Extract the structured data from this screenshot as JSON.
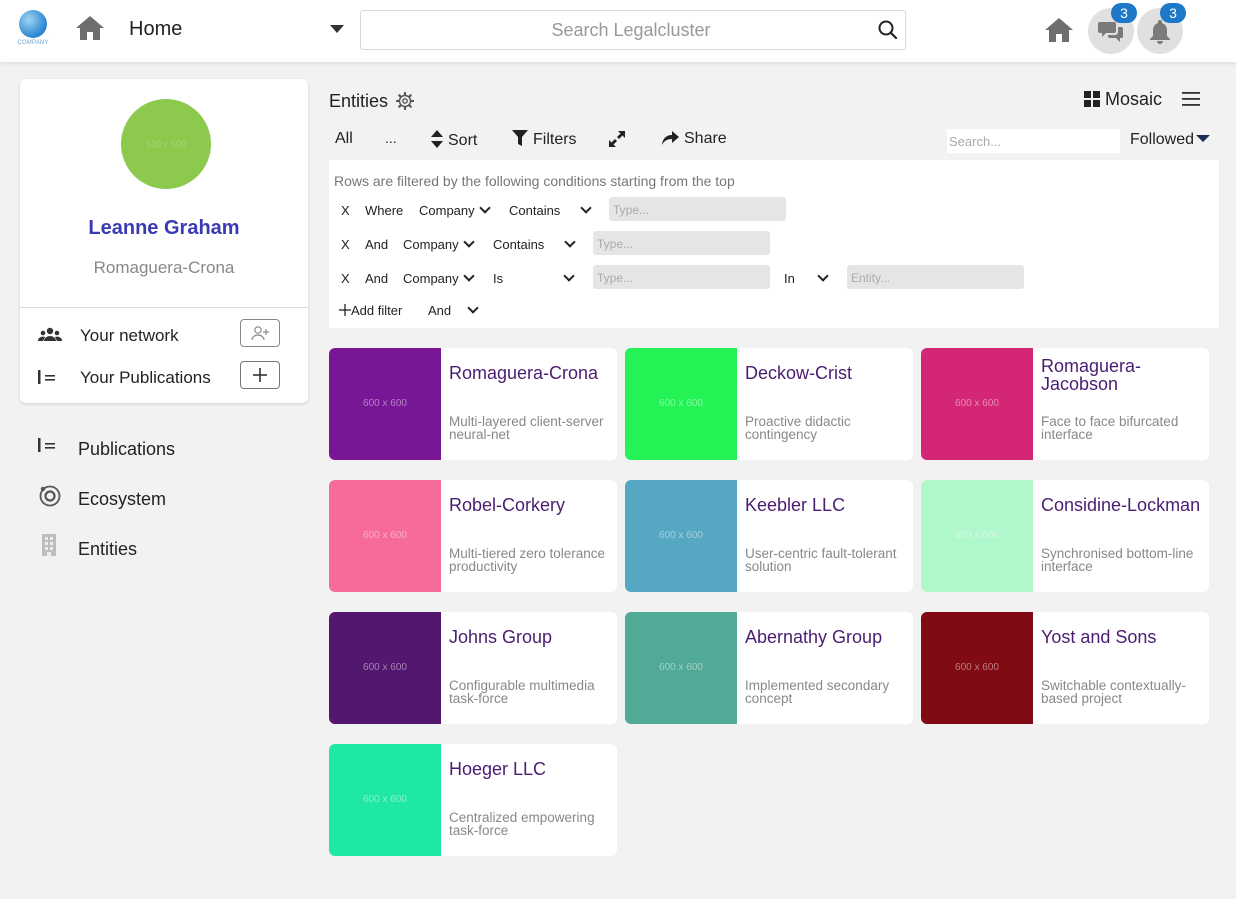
{
  "header": {
    "logo_text": "COMPANY",
    "title": "Home",
    "search_placeholder": "Search Legalcluster",
    "messages_count": "3",
    "notifications_count": "3"
  },
  "profile": {
    "avatar_text": "600 x 600",
    "avatar_color": "#8cc94d",
    "name": "Leanne Graham",
    "company": "Romaguera-Crona",
    "network_label": "Your network",
    "publications_label": "Your Publications"
  },
  "sidebar": {
    "items": [
      {
        "label": "Publications",
        "icon": "publications-icon"
      },
      {
        "label": "Ecosystem",
        "icon": "ecosystem-icon"
      },
      {
        "label": "Entities",
        "icon": "entities-icon"
      }
    ]
  },
  "main": {
    "title": "Entities",
    "view_label": "Mosaic",
    "toolbar": {
      "all": "All",
      "more": "...",
      "sort": "Sort",
      "filters": "Filters",
      "share": "Share",
      "search_placeholder": "Search...",
      "followed": "Followed"
    },
    "filter_panel": {
      "note": "Rows are filtered by the following conditions starting from the top",
      "rows": [
        {
          "remove": "X",
          "connector": "Where",
          "field": "Company",
          "operator": "Contains",
          "value_placeholder": "Type..."
        },
        {
          "remove": "X",
          "connector": "And",
          "field": "Company",
          "operator": "Contains",
          "value_placeholder": "Type..."
        },
        {
          "remove": "X",
          "connector": "And",
          "field": "Company",
          "operator": "Is",
          "value_placeholder": "Type...",
          "in_label": "In",
          "entity_placeholder": "Entity..."
        }
      ],
      "add_filter": "Add filter",
      "add_connector": "And"
    },
    "cards": [
      {
        "name": "Romaguera-Crona",
        "desc": "Multi-layered client-server neural-net",
        "img_text": "600 x 600",
        "color": "#771796"
      },
      {
        "name": "Deckow-Crist",
        "desc": "Proactive didactic contingency",
        "img_text": "600 x 600",
        "color": "#24f355"
      },
      {
        "name": "Romaguera-Jacobson",
        "desc": "Face to face bifurcated interface",
        "img_text": "600 x 600",
        "color": "#d32776"
      },
      {
        "name": "Robel-Corkery",
        "desc": "Multi-tiered zero tolerance productivity",
        "img_text": "600 x 600",
        "color": "#f66b97"
      },
      {
        "name": "Keebler LLC",
        "desc": "User-centric fault-tolerant solution",
        "img_text": "600 x 600",
        "color": "#56a8c2"
      },
      {
        "name": "Considine-Lockman",
        "desc": "Synchronised bottom-line interface",
        "img_text": "600 x 600",
        "color": "#b0f7cc"
      },
      {
        "name": "Johns Group",
        "desc": "Configurable multimedia task-force",
        "img_text": "600 x 600",
        "color": "#54176f"
      },
      {
        "name": "Abernathy Group",
        "desc": "Implemented secondary concept",
        "img_text": "600 x 600",
        "color": "#51aa97"
      },
      {
        "name": "Yost and Sons",
        "desc": "Switchable contextually-based project",
        "img_text": "600 x 600",
        "color": "#810b14"
      },
      {
        "name": "Hoeger LLC",
        "desc": "Centralized empowering task-force",
        "img_text": "600 x 600",
        "color": "#1ee8a4"
      }
    ]
  }
}
